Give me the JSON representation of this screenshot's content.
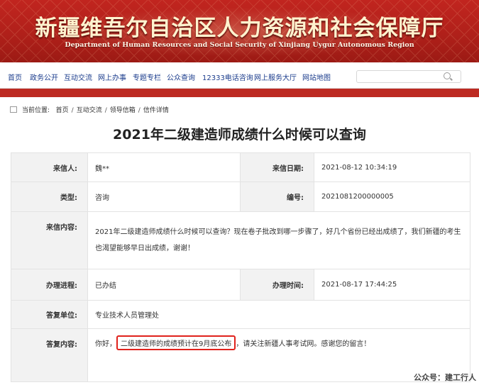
{
  "site": {
    "title_cn": "新疆维吾尔自治区人力资源和社会保障厅",
    "title_en": "Department of Human Resources and Social Security of Xinjiang Uygur Autonomous Region"
  },
  "nav": {
    "items": [
      "首页",
      "政务公开",
      "互动交流",
      "网上办事",
      "专题专栏",
      "公众查询",
      "12333电话咨询",
      "网上服务大厅",
      "网站地图"
    ]
  },
  "breadcrumb": {
    "prefix": "当前位置:",
    "items": [
      "首页",
      "互动交流",
      "领导信箱",
      "信件详情"
    ]
  },
  "page": {
    "title": "2021年二级建造师成绩什么时候可以查询"
  },
  "letter": {
    "sender_label": "来信人:",
    "sender": "魏**",
    "date_label": "来信日期:",
    "date": "2021-08-12 10:34:19",
    "type_label": "类型:",
    "type": "咨询",
    "number_label": "编号:",
    "number": "2021081200000005",
    "content_label": "来信内容:",
    "content": "2021年二级建造师成绩什么时候可以查询？现在卷子批改到哪一步骤了，好几个省份已经出成绩了，我们新疆的考生也渴望能够早日出成绩，谢谢！",
    "progress_label": "办理进程:",
    "progress": "已办结",
    "handle_time_label": "办理时间:",
    "handle_time": "2021-08-17 17:44:25",
    "reply_unit_label": "答复单位:",
    "reply_unit": "专业技术人员管理处",
    "reply_label": "答复内容:",
    "reply_pre": "你好，",
    "reply_highlight": "二级建造师的成绩预计在9月底公布",
    "reply_post": "，请关注新疆人事考试网。感谢您的留言！"
  },
  "watermark": "公众号：建工行人",
  "colors": {
    "banner": "#b0201a",
    "nav_text": "#1b3c8c",
    "highlight": "#e0221c"
  }
}
